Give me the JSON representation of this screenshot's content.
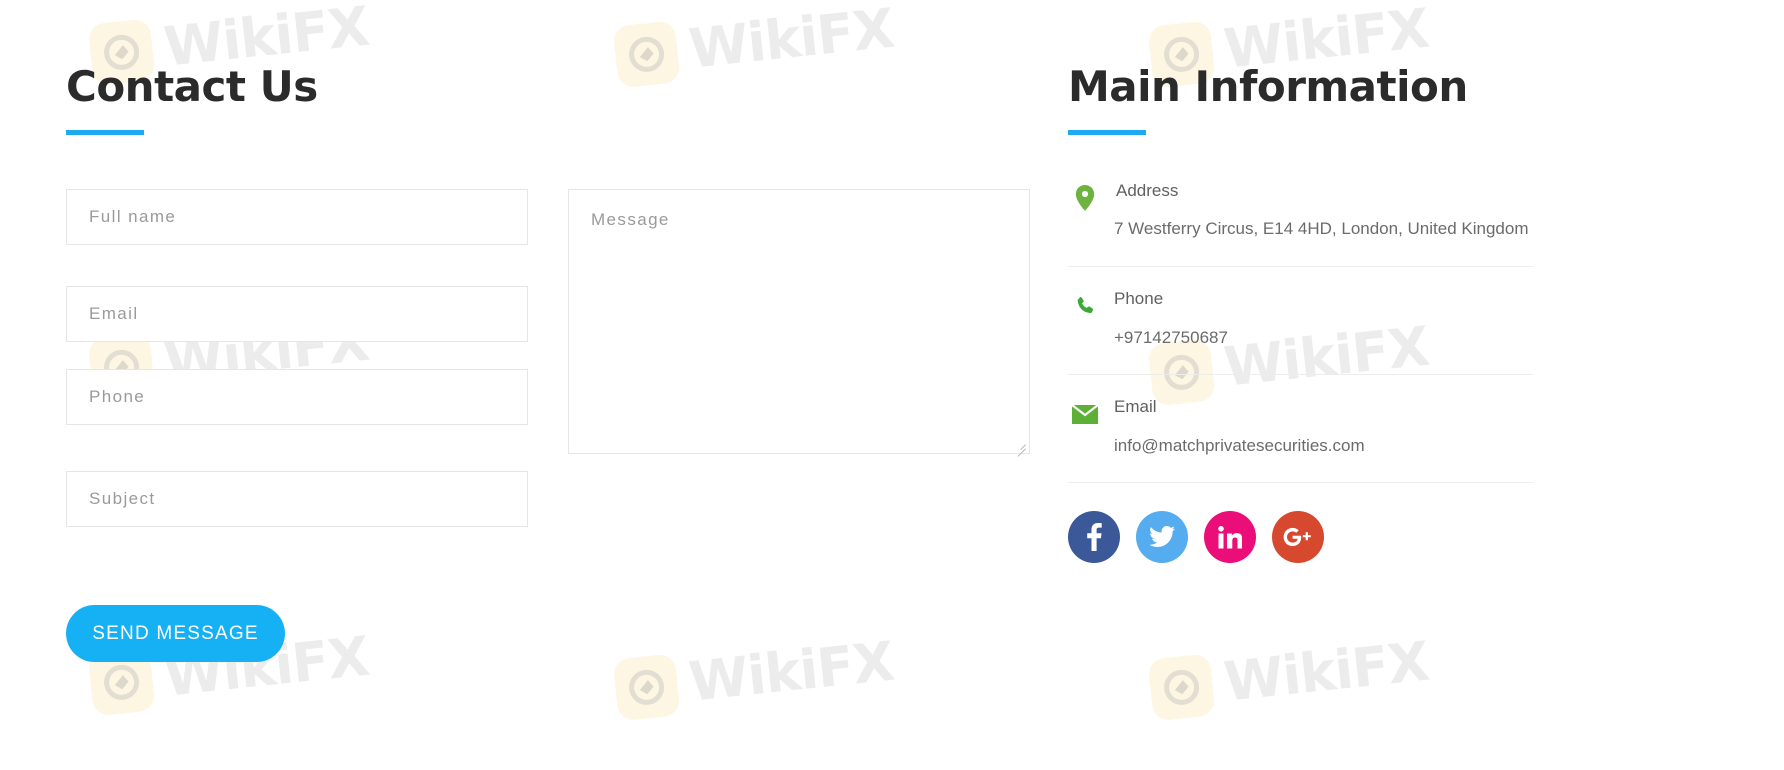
{
  "contact": {
    "title": "Contact Us",
    "fields": [
      {
        "name": "full-name",
        "placeholder": "Full name",
        "value": ""
      },
      {
        "name": "email",
        "placeholder": "Email",
        "value": ""
      },
      {
        "name": "phone",
        "placeholder": "Phone",
        "value": ""
      },
      {
        "name": "subject",
        "placeholder": "Subject",
        "value": ""
      }
    ],
    "message": {
      "placeholder": "Message",
      "value": ""
    },
    "submit_label": "SEND MESSAGE",
    "accent_color": "#16b0f4"
  },
  "info": {
    "title": "Main Information",
    "rows": [
      {
        "icon": "location-pin-icon",
        "icon_color": "#6cb33f",
        "label": "Address",
        "value": "7 Westferry Circus, E14 4HD, London, United Kingdom"
      },
      {
        "icon": "phone-icon",
        "icon_color": "#3aaa35",
        "label": "Phone",
        "value": "+97142750687"
      },
      {
        "icon": "envelope-icon",
        "icon_color": "#5cb035",
        "label": "Email",
        "value": "info@matchprivatesecurities.com"
      }
    ],
    "social": [
      {
        "name": "facebook",
        "glyph": "f",
        "color": "#3b5998"
      },
      {
        "name": "twitter",
        "glyph": "",
        "color": "#55acee"
      },
      {
        "name": "linkedin",
        "glyph": "in",
        "color": "#ec0e78"
      },
      {
        "name": "googleplus",
        "glyph": "G+",
        "color": "#d6492f"
      }
    ]
  },
  "watermark": {
    "text": "WikiFX",
    "text_color": "#ececec",
    "badge_color": "#fdf6e3"
  }
}
